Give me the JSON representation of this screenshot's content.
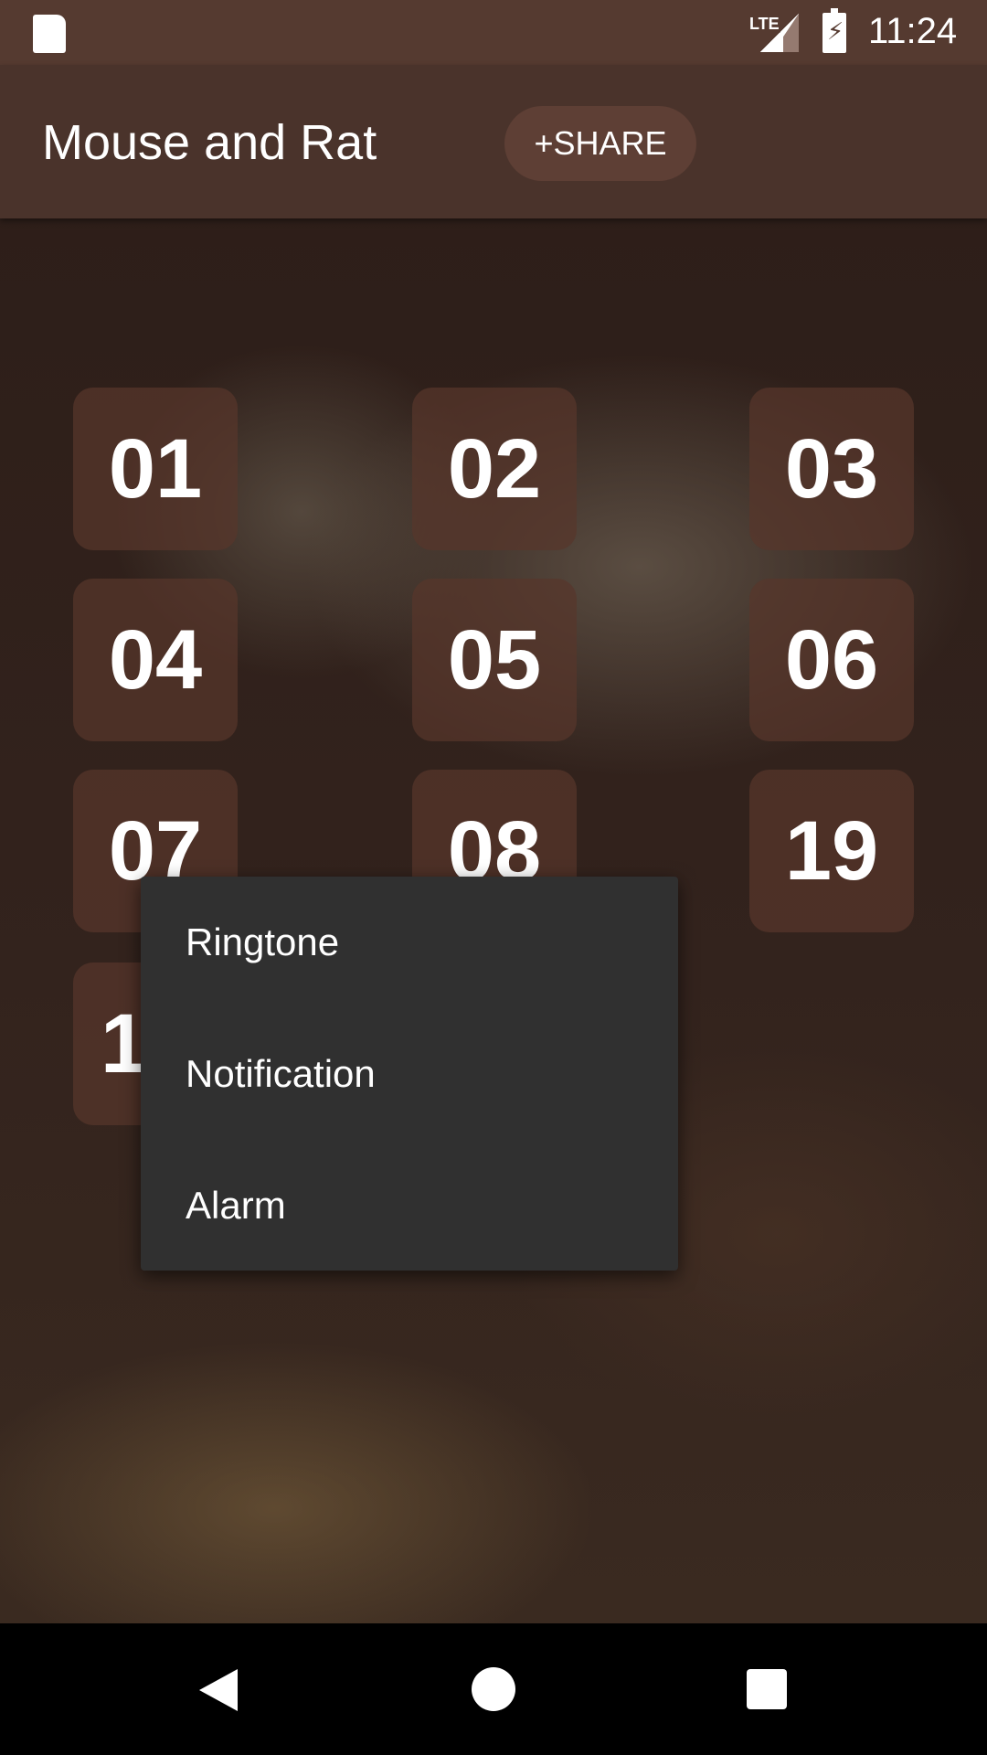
{
  "status_bar": {
    "time": "11:24",
    "network": "LTE",
    "icons": [
      "sd-card-icon",
      "signal-icon",
      "battery-charging-icon"
    ]
  },
  "app_bar": {
    "title": "Mouse and Rat",
    "share_label": "+SHARE"
  },
  "sound_buttons": [
    "01",
    "02",
    "03",
    "04",
    "05",
    "06",
    "07",
    "08",
    "19",
    "1"
  ],
  "context_menu": {
    "items": [
      "Ringtone",
      "Notification",
      "Alarm"
    ]
  },
  "nav_bar": {
    "icons": [
      "back-icon",
      "home-icon",
      "recents-icon"
    ]
  }
}
